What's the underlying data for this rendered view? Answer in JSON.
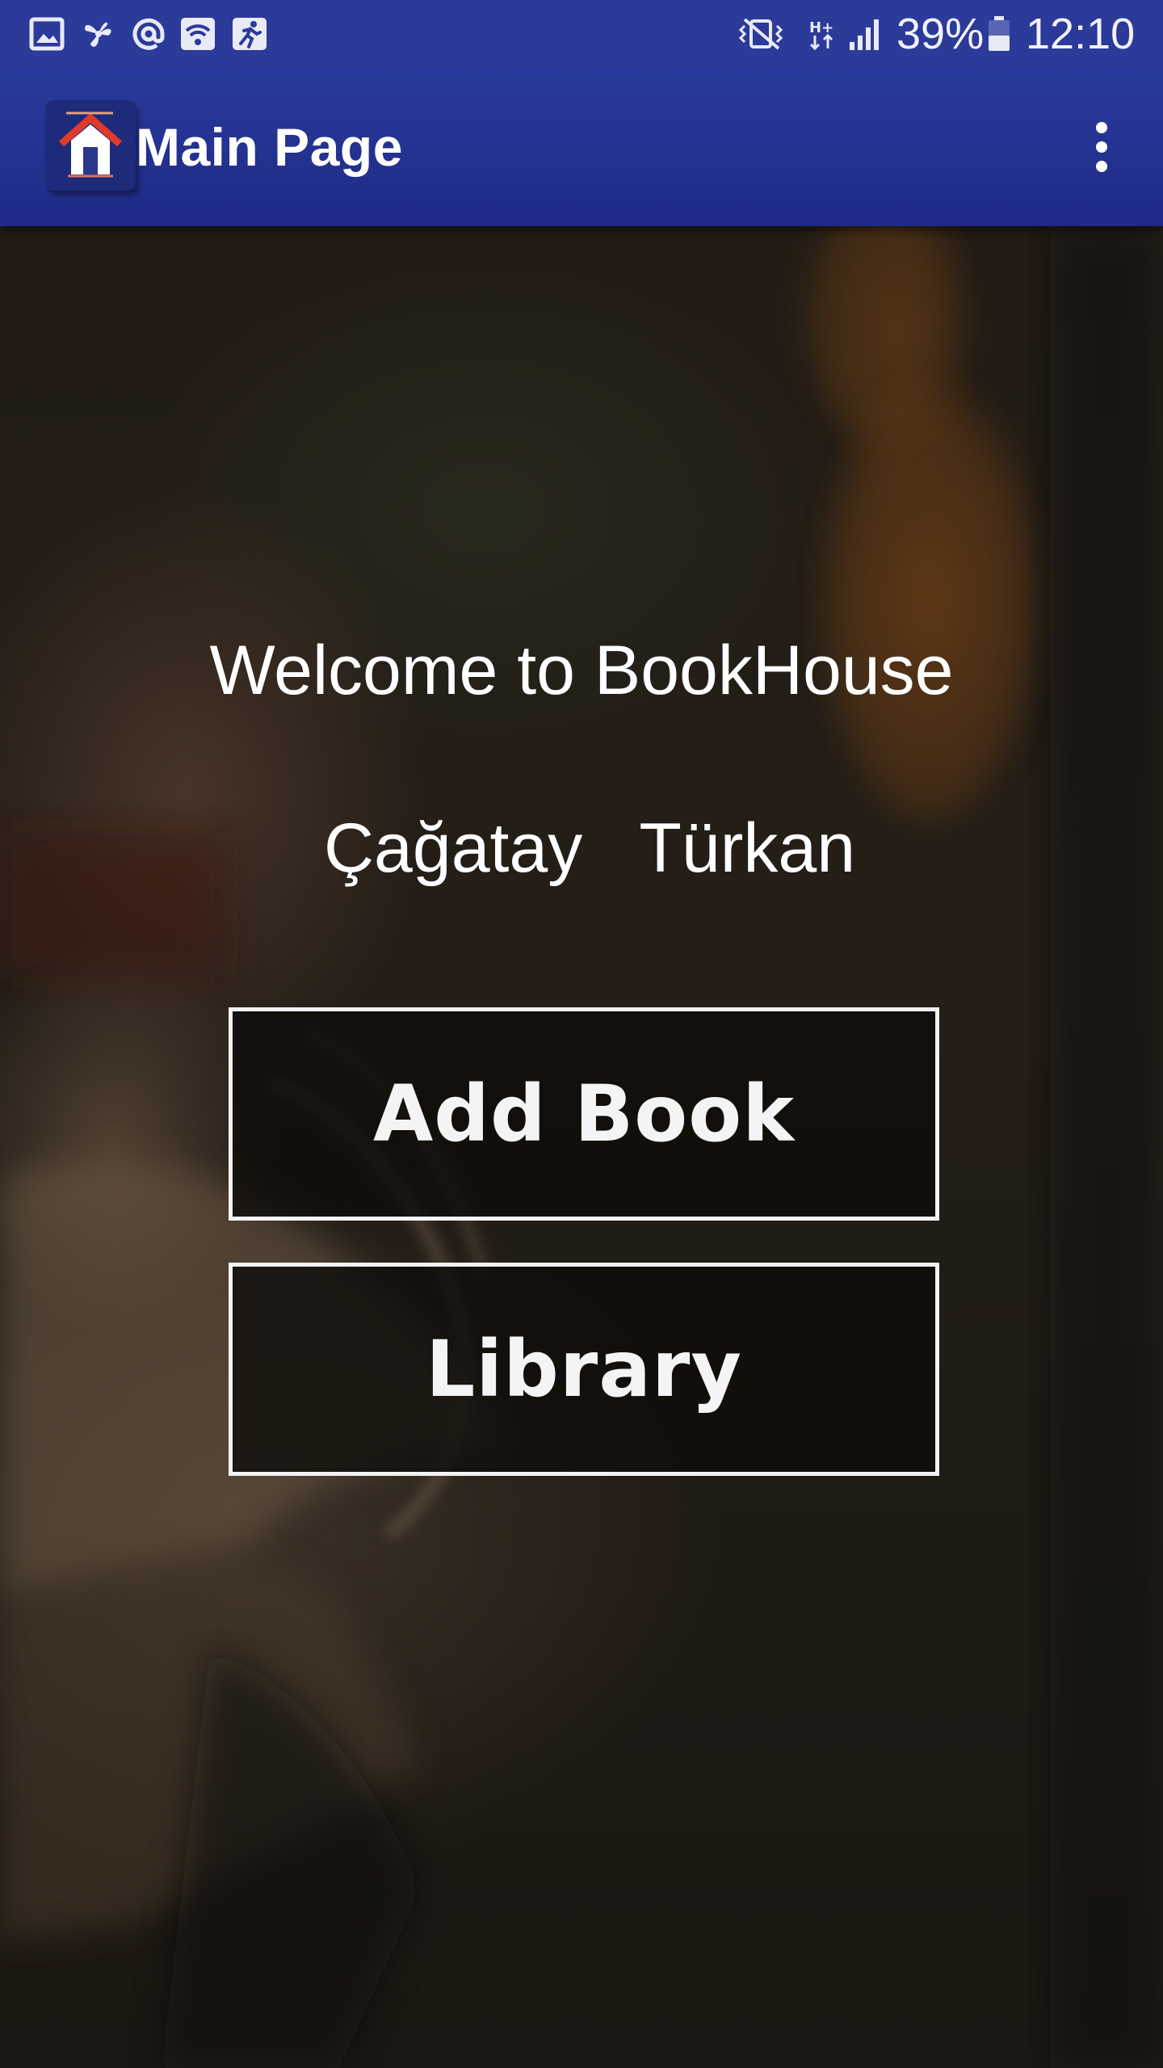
{
  "status_bar": {
    "battery": "39%",
    "time": "12:10",
    "left_icons": [
      "gallery-icon",
      "pinwheel-icon",
      "at-icon",
      "wifi-question-icon",
      "activity-runner-icon"
    ],
    "right_icons": [
      "mute-vibrate-icon",
      "network-hplus-icon",
      "signal-icon",
      "battery-icon"
    ]
  },
  "app_bar": {
    "title": "Main Page",
    "logo_icon": "house-logo-icon",
    "menu_icon": "overflow-menu-icon"
  },
  "main": {
    "welcome": "Welcome to BookHouse",
    "author": "Çağatay   Türkan",
    "buttons": {
      "add_book": "Add Book",
      "library": "Library"
    }
  },
  "colors": {
    "primary": "#2c3a9a",
    "primary_dark": "#1f2a86",
    "background": "#221c15",
    "text": "#ffffff"
  }
}
